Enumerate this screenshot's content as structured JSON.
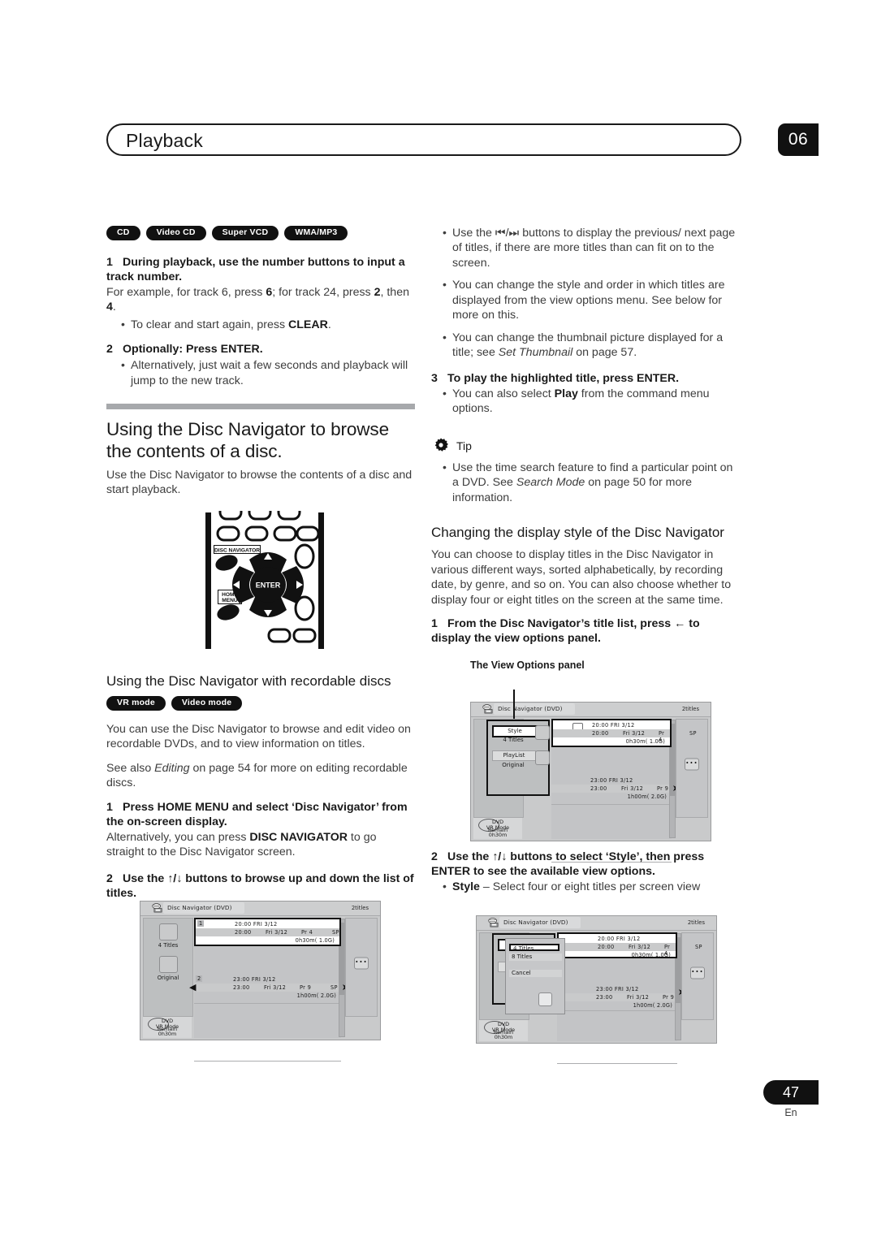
{
  "header": {
    "title": "Playback",
    "chapter": "06"
  },
  "footer": {
    "page": "47",
    "lang": "En"
  },
  "left_column": {
    "format_badges": [
      "CD",
      "Video CD",
      "Super VCD",
      "WMA/MP3"
    ],
    "step1_title": "During playback, use the number buttons to input a track number.",
    "step1_num": "1",
    "step1_body_1": "For example, for track 6, press ",
    "step1_body_b1": "6",
    "step1_body_2": "; for track 24, press ",
    "step1_body_b2": "2",
    "step1_body_3": ", then ",
    "step1_body_b3": "4",
    "step1_body_4": ".",
    "step1_bullet_1": "To clear and start again, press ",
    "step1_bullet_1_b": "CLEAR",
    "step1_bullet_1_end": ".",
    "step2_num": "2",
    "step2_title": "Optionally: Press ENTER.",
    "step2_bullet_1": "Alternatively, just wait a few seconds and playback will jump to the new track.",
    "section_heading": "Using the Disc Navigator to browse the contents of a disc.",
    "section_body": "Use the Disc Navigator to browse the contents of a disc and start playback.",
    "remote": {
      "disc_navigator_label": "DISC NAVIGATOR",
      "home_menu_label_1": "HOME",
      "home_menu_label_2": "MENU",
      "enter_label": "ENTER"
    },
    "sub_heading": "Using the Disc Navigator with recordable discs",
    "mode_badges": [
      "VR mode",
      "Video mode"
    ],
    "para_1": "You can use the Disc Navigator to browse and edit video on recordable DVDs, and to view information on  titles.",
    "para_2_a": "See also ",
    "para_2_i": "Editing",
    "para_2_b": " on page 54 for more on editing recordable discs.",
    "step3_num": "1",
    "step3_title": "Press HOME MENU and select ‘Disc Navigator’ from the on-screen display.",
    "step3_body_a": "Alternatively, you can press ",
    "step3_body_b": "DISC NAVIGATOR",
    "step3_body_c": " to go straight to the Disc Navigator screen.",
    "step4_num": "2",
    "step4_title_a": "Use the ",
    "step4_title_arrows": "↑/↓",
    "step4_title_b": " buttons to browse up and down the list of titles."
  },
  "right_column": {
    "bullet_1_a": "Use the ",
    "bullet_1_icons": "⏮/⏭",
    "bullet_1_b": " buttons to display the previous/ next page of titles, if there are more titles than can fit on to the screen.",
    "bullet_2": "You can change the style and order in which titles are displayed from the view options menu. See below for more on this.",
    "bullet_3_a": "You can change the thumbnail picture displayed for a title; see ",
    "bullet_3_i": "Set Thumbnail",
    "bullet_3_b": " on page 57.",
    "step3_num": "3",
    "step3_title": "To play the highlighted title, press ENTER.",
    "step3_bullet_a": "You can also select ",
    "step3_bullet_b": "Play",
    "step3_bullet_c": " from the command menu options.",
    "tip_label": "Tip",
    "tip_bullet_a": "Use the time search feature to find a particular point on a DVD. See ",
    "tip_bullet_i": "Search Mode",
    "tip_bullet_b": " on page 50 for more information.",
    "sub_heading": "Changing the display style of the Disc Navigator",
    "para_1": "You can choose to display titles in the Disc Navigator in various different ways, sorted alphabetically, by recording date, by genre, and so on. You can also choose whether to display four or eight titles on the screen at the same time.",
    "step1_num": "1",
    "step1_title_a": "From the Disc Navigator’s title list, press ",
    "step1_arrow": "←",
    "step1_title_b": " to display the view options panel.",
    "view_options_caption": "The View Options panel",
    "step2_num": "2",
    "step2_title_a": "Use the ",
    "step2_arrows": "↑/↓",
    "step2_title_b": " buttons to select ‘Style’, then press ENTER to see the available view options.",
    "step2_bullet_b": "Style",
    "step2_bullet_rest": " – Select four or eight titles per screen view"
  },
  "osd": {
    "title": "Disc Navigator (DVD)",
    "count": "2titles",
    "left_panel": {
      "titles_label": "4 Titles",
      "playlist_label": "Original"
    },
    "status": {
      "mode_line1": "DVD",
      "mode_line2": "VR Mode",
      "remain_label": "Remain",
      "remain_value": "0h30m"
    },
    "rows": [
      {
        "num": "1",
        "line1": "20:00  FRI  3/12",
        "time": "20:00",
        "date": "Fri 3/12",
        "pr": "Pr  4",
        "mode": "SP",
        "size": "0h30m( 1.0G)"
      },
      {
        "num": "2",
        "line1": "23:00  FRI  3/12",
        "time": "23:00",
        "date": "Fri 3/12",
        "pr": "Pr  9",
        "mode": "SP",
        "size": "1h00m( 2.0G)"
      }
    ],
    "command_dots": "•••",
    "view_options": {
      "style_label": "Style",
      "style_value": "4 Titles",
      "playlist_label": "PlayList",
      "playlist_value": "Original"
    },
    "style_dropdown": {
      "option_1": "4 Titles",
      "option_2": "8 Titles",
      "cancel": "Cancel"
    }
  }
}
